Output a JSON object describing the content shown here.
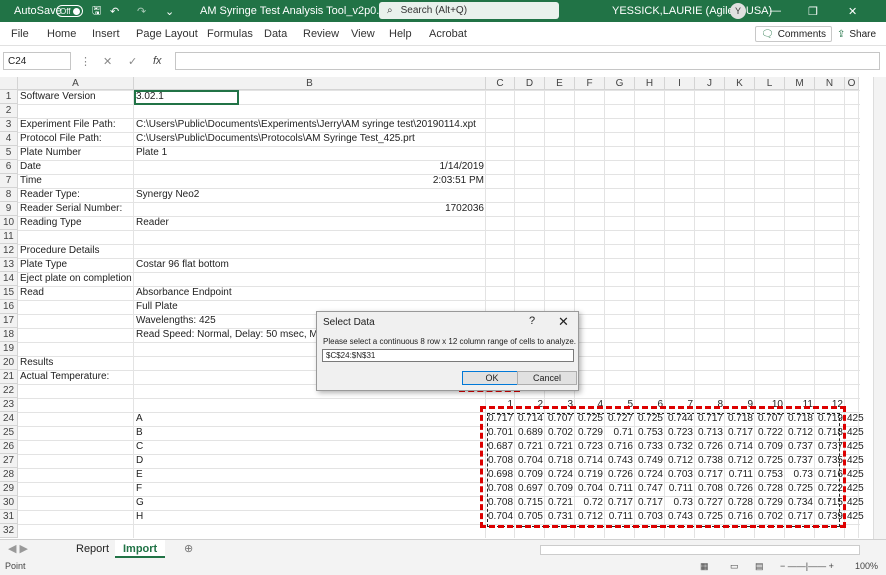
{
  "titlebar": {
    "autosave_label": "AutoSave",
    "autosave_state": "Off",
    "filename": "AM Syringe Test Analysis Tool_v2p0.xlsm",
    "search_placeholder": "Search (Alt+Q)",
    "user": "YESSICK,LAURIE (Agilent USA)",
    "avatar_initial": "Y"
  },
  "menu": {
    "items": [
      "File",
      "Home",
      "Insert",
      "Page Layout",
      "Formulas",
      "Data",
      "Review",
      "View",
      "Help",
      "Acrobat"
    ],
    "comments": "Comments",
    "share": "Share"
  },
  "formula_bar": {
    "name_box": "C24",
    "fx": "fx"
  },
  "columns": [
    "A",
    "B",
    "C",
    "D",
    "E",
    "F",
    "G",
    "H",
    "I",
    "J",
    "K",
    "L",
    "M",
    "N",
    "O"
  ],
  "rows": [
    "1",
    "2",
    "3",
    "4",
    "5",
    "6",
    "7",
    "8",
    "9",
    "10",
    "11",
    "12",
    "13",
    "14",
    "15",
    "16",
    "17",
    "18",
    "19",
    "20",
    "21",
    "22",
    "23",
    "24",
    "25",
    "26",
    "27",
    "28",
    "29",
    "30",
    "31",
    "32"
  ],
  "sheet": {
    "a1": "Software Version",
    "b1": "3.02.1",
    "a3": "Experiment File Path:",
    "b3": "C:\\Users\\Public\\Documents\\Experiments\\Jerry\\AM syringe test\\20190114.xpt",
    "a4": "Protocol File Path:",
    "b4": "C:\\Users\\Public\\Documents\\Protocols\\AM Syringe Test_425.prt",
    "a5": "Plate Number",
    "b5": "Plate 1",
    "a6": "Date",
    "b6": "1/14/2019",
    "a7": "Time",
    "b7": "2:03:51 PM",
    "a8": "Reader Type:",
    "b8": "Synergy Neo2",
    "a9": "Reader Serial Number:",
    "b9": "1702036",
    "a10": "Reading Type",
    "b10": "Reader",
    "a12": "Procedure Details",
    "a13": "Plate Type",
    "b13": "Costar 96 flat bottom",
    "a14": "Eject plate on completion",
    "a15": "Read",
    "b15": "Absorbance Endpoint",
    "b16": "Full Plate",
    "b17": "Wavelengths:  425",
    "b18": "Read Speed: Normal,  Delay: 50 msec,  Me",
    "a20": "Results",
    "a21": "Actual Temperature:"
  },
  "plate": {
    "col_headers": [
      "1",
      "2",
      "3",
      "4",
      "5",
      "6",
      "7",
      "8",
      "9",
      "10",
      "11",
      "12"
    ],
    "row_labels": [
      "A",
      "B",
      "C",
      "D",
      "E",
      "F",
      "G",
      "H"
    ],
    "values": [
      [
        "0.717",
        "0.714",
        "0.707",
        "0.725",
        "0.727",
        "0.725",
        "0.744",
        "0.717",
        "0.718",
        "0.707",
        "0.718",
        "0.719"
      ],
      [
        "0.701",
        "0.689",
        "0.702",
        "0.729",
        "0.71",
        "0.753",
        "0.723",
        "0.713",
        "0.717",
        "0.722",
        "0.712",
        "0.718"
      ],
      [
        "0.687",
        "0.721",
        "0.721",
        "0.723",
        "0.716",
        "0.733",
        "0.732",
        "0.726",
        "0.714",
        "0.709",
        "0.737",
        "0.737"
      ],
      [
        "0.708",
        "0.704",
        "0.718",
        "0.714",
        "0.743",
        "0.749",
        "0.712",
        "0.738",
        "0.712",
        "0.725",
        "0.737",
        "0.735"
      ],
      [
        "0.698",
        "0.709",
        "0.724",
        "0.719",
        "0.726",
        "0.724",
        "0.703",
        "0.717",
        "0.711",
        "0.753",
        "0.73",
        "0.716"
      ],
      [
        "0.708",
        "0.697",
        "0.709",
        "0.704",
        "0.711",
        "0.747",
        "0.711",
        "0.708",
        "0.726",
        "0.728",
        "0.725",
        "0.722"
      ],
      [
        "0.708",
        "0.715",
        "0.721",
        "0.72",
        "0.717",
        "0.717",
        "0.73",
        "0.727",
        "0.728",
        "0.729",
        "0.734",
        "0.715"
      ],
      [
        "0.704",
        "0.705",
        "0.731",
        "0.712",
        "0.711",
        "0.703",
        "0.743",
        "0.725",
        "0.716",
        "0.702",
        "0.717",
        "0.739"
      ]
    ],
    "trailing": "425"
  },
  "dialog": {
    "title": "Select Data",
    "help": "?",
    "close": "✕",
    "prompt": "Please select a continuous 8 row x 12 column range of cells to analyze.",
    "range": "$C$24:$N$31",
    "ok": "OK",
    "cancel": "Cancel"
  },
  "tabs": [
    "Report",
    "Import"
  ],
  "status": {
    "mode": "Point",
    "zoom": "100%"
  }
}
